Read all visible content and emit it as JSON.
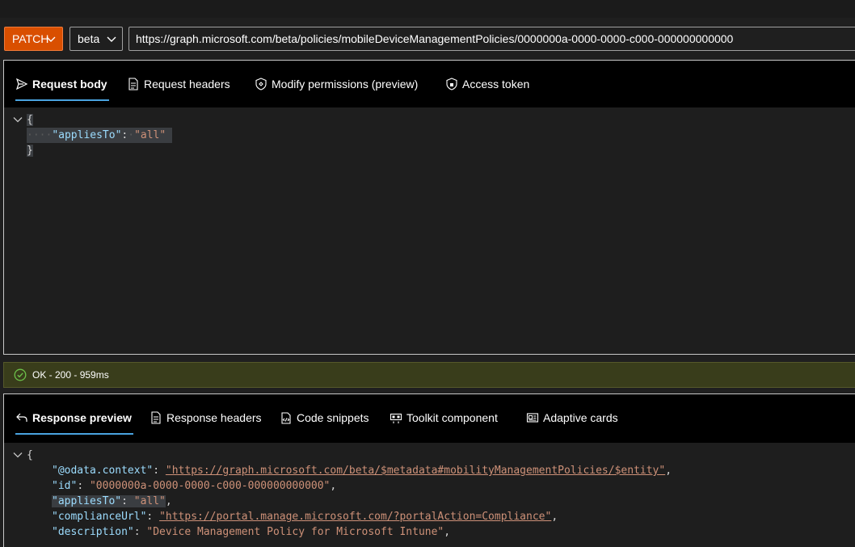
{
  "toolbar": {
    "method": "PATCH",
    "version": "beta",
    "url": "https://graph.microsoft.com/beta/policies/mobileDeviceManagementPolicies/0000000a-0000-0000-c000-000000000000"
  },
  "request_tabs": [
    {
      "label": "Request body",
      "icon": "send-icon",
      "active": true
    },
    {
      "label": "Request headers",
      "icon": "document-icon",
      "active": false
    },
    {
      "label": "Modify permissions (preview)",
      "icon": "shield-icon",
      "active": false
    },
    {
      "label": "Access token",
      "icon": "lock-icon",
      "active": false
    }
  ],
  "request_body": {
    "open_brace": "{",
    "key": "\"appliesTo\"",
    "colon": ":",
    "value": "\"all\"",
    "close_brace": "}"
  },
  "status": {
    "text": "OK - 200 - 959ms",
    "icon": "check-circle-icon",
    "color": "#393d1b"
  },
  "response_tabs": [
    {
      "label": "Response preview",
      "icon": "arrow-back-icon",
      "active": true
    },
    {
      "label": "Response headers",
      "icon": "document-icon",
      "active": false
    },
    {
      "label": "Code snippets",
      "icon": "code-icon",
      "active": false
    },
    {
      "label": "Toolkit component",
      "icon": "toolkit-icon",
      "active": false
    },
    {
      "label": "Adaptive cards",
      "icon": "card-icon",
      "active": false
    }
  ],
  "response": {
    "open_brace": "{",
    "lines": [
      {
        "key": "\"@odata.context\"",
        "value": "\"https://graph.microsoft.com/beta/$metadata#mobilityManagementPolicies/$entity\"",
        "link": true
      },
      {
        "key": "\"id\"",
        "value": "\"0000000a-0000-0000-c000-000000000000\"",
        "link": false
      },
      {
        "key": "\"appliesTo\"",
        "value": "\"all\"",
        "link": false
      },
      {
        "key": "\"complianceUrl\"",
        "value": "\"https://portal.manage.microsoft.com/?portalAction=Compliance\"",
        "link": true
      },
      {
        "key": "\"description\"",
        "value": "\"Device Management Policy for Microsoft Intune\"",
        "link": false
      }
    ]
  },
  "colors": {
    "accent": "#4aa3df",
    "method_bg": "#d94f00",
    "json_key": "#9cdcfe",
    "json_string": "#ce9178"
  }
}
